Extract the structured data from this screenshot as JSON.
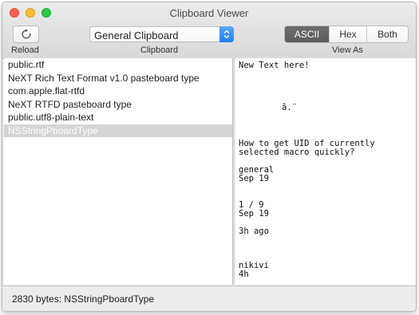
{
  "window": {
    "title": "Clipboard Viewer"
  },
  "toolbar": {
    "reload_label": "Reload",
    "clipboard_select_value": "General Clipboard",
    "clipboard_label": "Clipboard",
    "view_as_label": "View As",
    "view_modes": [
      "ASCII",
      "Hex",
      "Both"
    ],
    "selected_view_mode": "ASCII"
  },
  "types_list": [
    "public.rtf",
    "NeXT Rich Text Format v1.0 pasteboard type",
    "com.apple.flat-rtfd",
    "NeXT RTFD pasteboard type",
    "public.utf8-plain-text",
    "NSStringPboardType"
  ],
  "selected_type": "NSStringPboardType",
  "content_lines": [
    "New Text here!",
    "â.¨",
    "How to get UID of currently",
    "selected macro quickly?",
    "general",
    "Sep 19",
    "1 / 9",
    "Sep 19",
    "3h ago",
    "nikivi",
    "4h"
  ],
  "status": {
    "text": "2830 bytes: NSStringPboardType"
  }
}
